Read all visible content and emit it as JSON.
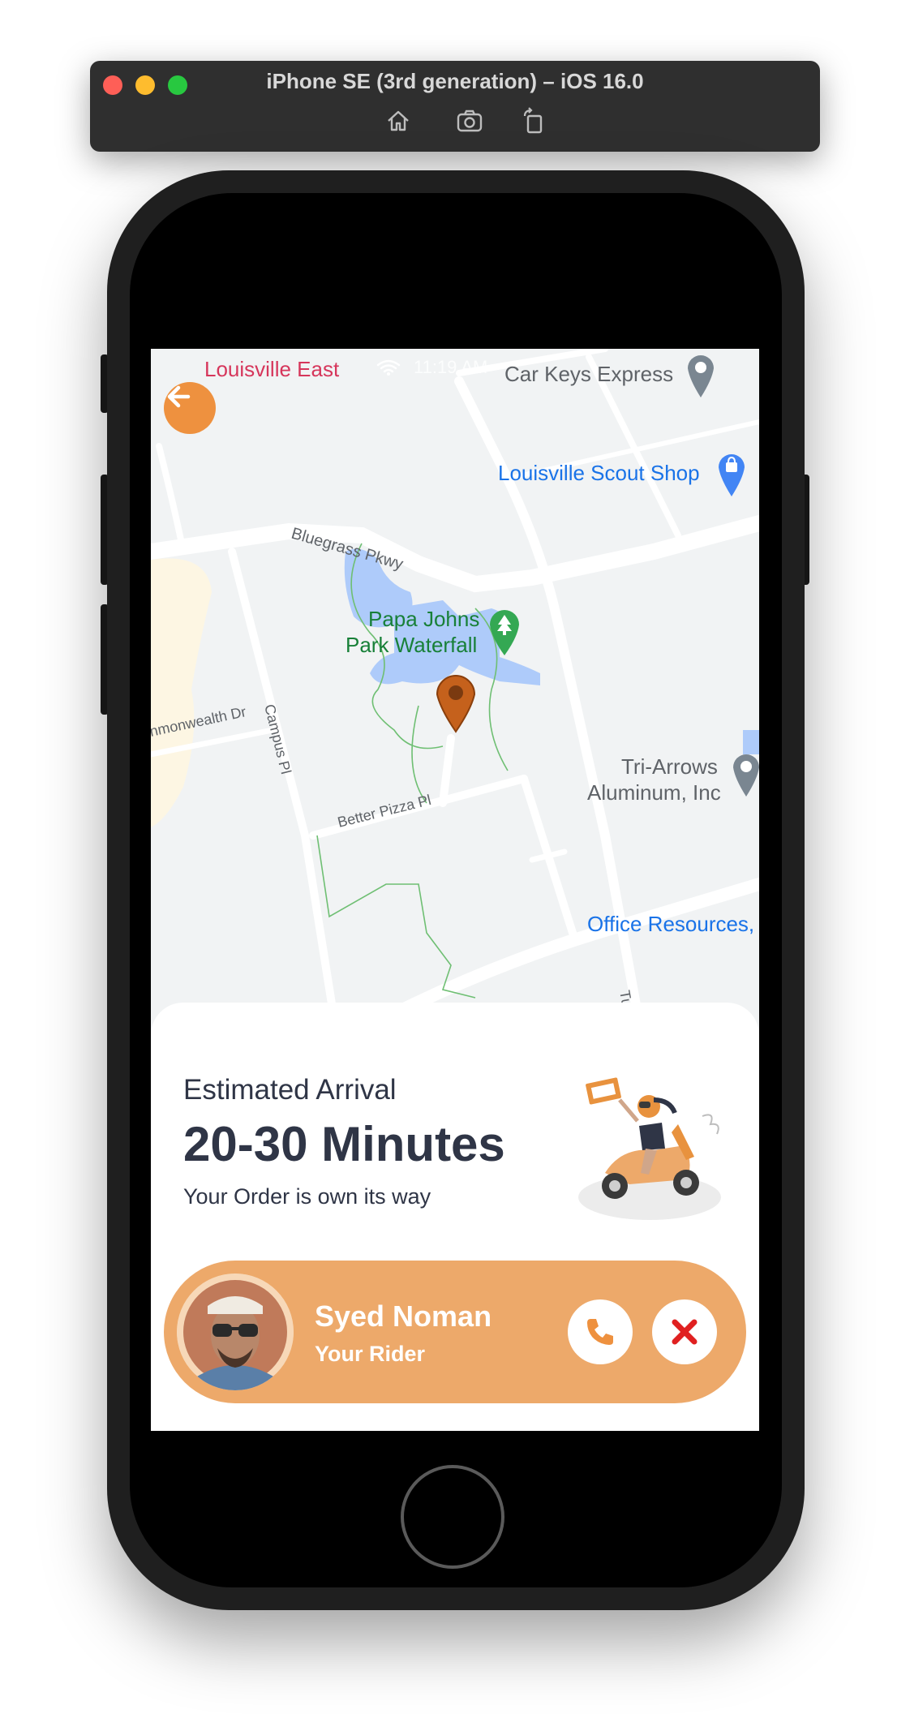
{
  "simulator": {
    "title": "iPhone SE (3rd generation) – iOS 16.0",
    "tools": [
      "home-icon",
      "screenshot-icon",
      "rotate-icon"
    ]
  },
  "status_bar": {
    "hotel_line": "Louisville East",
    "time": "11:19 AM"
  },
  "map": {
    "pois": {
      "car_keys": "Car Keys Express",
      "scout_shop": "Louisville Scout Shop",
      "park_line1": "Papa Johns",
      "park_line2": "Park Waterfall",
      "tri_arrows_line1": "Tri-Arrows",
      "tri_arrows_line2": "Aluminum, Inc",
      "office": "Office Resources,"
    },
    "roads": {
      "bluegrass": "Bluegrass Pkwy",
      "commonwealth": "nmonwealth Dr",
      "campus": "Campus Pl",
      "better_pizza": "Better Pizza Pl",
      "tu": "Tu"
    },
    "colors": {
      "land": "#f1f3f4",
      "road": "#ffffff",
      "water": "#aecbfa",
      "poi_blue": "#1a73e8",
      "poi_green": "#188038",
      "marker": "#c5611c"
    }
  },
  "delivery": {
    "eta_label": "Estimated Arrival",
    "eta_value": "20-30 Minutes",
    "status": "Your Order is own its way"
  },
  "rider": {
    "name": "Syed Noman",
    "role": "Your Rider"
  },
  "theme": {
    "accent": "#ee913f",
    "card": "#eda96a",
    "text_dark": "#2f3546",
    "cancel_red": "#e02020"
  }
}
